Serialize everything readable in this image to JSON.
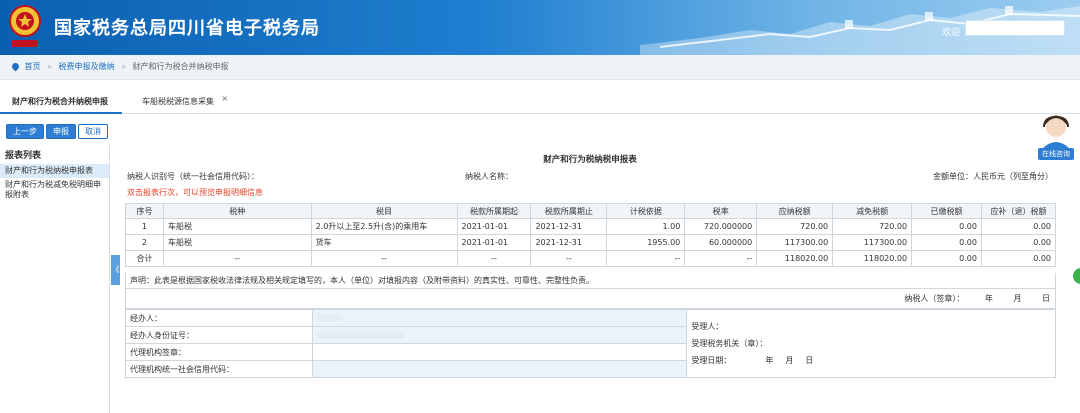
{
  "header": {
    "title": "国家税务总局四川省电子税务局",
    "welcome_label": "欢迎"
  },
  "breadcrumb": {
    "home": "首页",
    "level1": "税费申报及缴纳",
    "current": "财产和行为税合并纳税申报"
  },
  "tabs": [
    {
      "label": "财产和行为税合并纳税申报"
    },
    {
      "label": "车船税税源信息采集"
    }
  ],
  "tab_close": "×",
  "toolbar": {
    "prev": "上一步",
    "submit": "申报",
    "cancel": "取消"
  },
  "sidebar": {
    "title": "报表列表",
    "items": [
      "财产和行为税纳税申报表",
      "财产和行为税减免税明细申报附表"
    ],
    "collapse": "《"
  },
  "form": {
    "title": "财产和行为税纳税申报表",
    "taxpayer_id_label": "纳税人识别号（统一社会信用代码）：",
    "taxpayer_name_label": "纳税人名称：",
    "unit_label": "金额单位：人民币元（列至角分）",
    "hint": "双击报表行次，可以预览申报明细信息",
    "columns": [
      "序号",
      "税种",
      "税目",
      "税款所属期起",
      "税款所属期止",
      "计税依据",
      "税率",
      "应纳税额",
      "减免税额",
      "已缴税额",
      "应补（退）税额"
    ],
    "rows": [
      [
        "1",
        "车船税",
        "2.0升以上至2.5升(含)的乘用车",
        "2021-01-01",
        "2021-12-31",
        "1.00",
        "720.000000",
        "720.00",
        "720.00",
        "0.00",
        "0.00"
      ],
      [
        "2",
        "车船税",
        "货车",
        "2021-01-01",
        "2021-12-31",
        "1955.00",
        "60.000000",
        "117300.00",
        "117300.00",
        "0.00",
        "0.00"
      ]
    ],
    "total": [
      "合计",
      "--",
      "--",
      "--",
      "--",
      "--",
      "--",
      "118020.00",
      "118020.00",
      "0.00",
      "0.00"
    ],
    "declaration": "声明：此表是根据国家税收法律法规及相关规定填写的，本人（单位）对填报内容（及附带资料）的真实性、可靠性、完整性负责。",
    "sign": {
      "label": "纳税人（签章）：",
      "year": "年",
      "month": "月",
      "day": "日"
    },
    "bottom": {
      "agent": "经办人：",
      "agent_id": "经办人身份证号：",
      "agency_seal": "代理机构签章：",
      "agency_code": "代理机构统一社会信用代码：",
      "acceptor": "受理人：",
      "tax_office": "受理税务机关（章）：",
      "accept_date": "受理日期：",
      "year": "年",
      "month": "月",
      "day": "日"
    }
  },
  "service": {
    "label": "在线咨询"
  },
  "colors": {
    "brand": "#1f6fc4",
    "hint": "#e0452c"
  }
}
